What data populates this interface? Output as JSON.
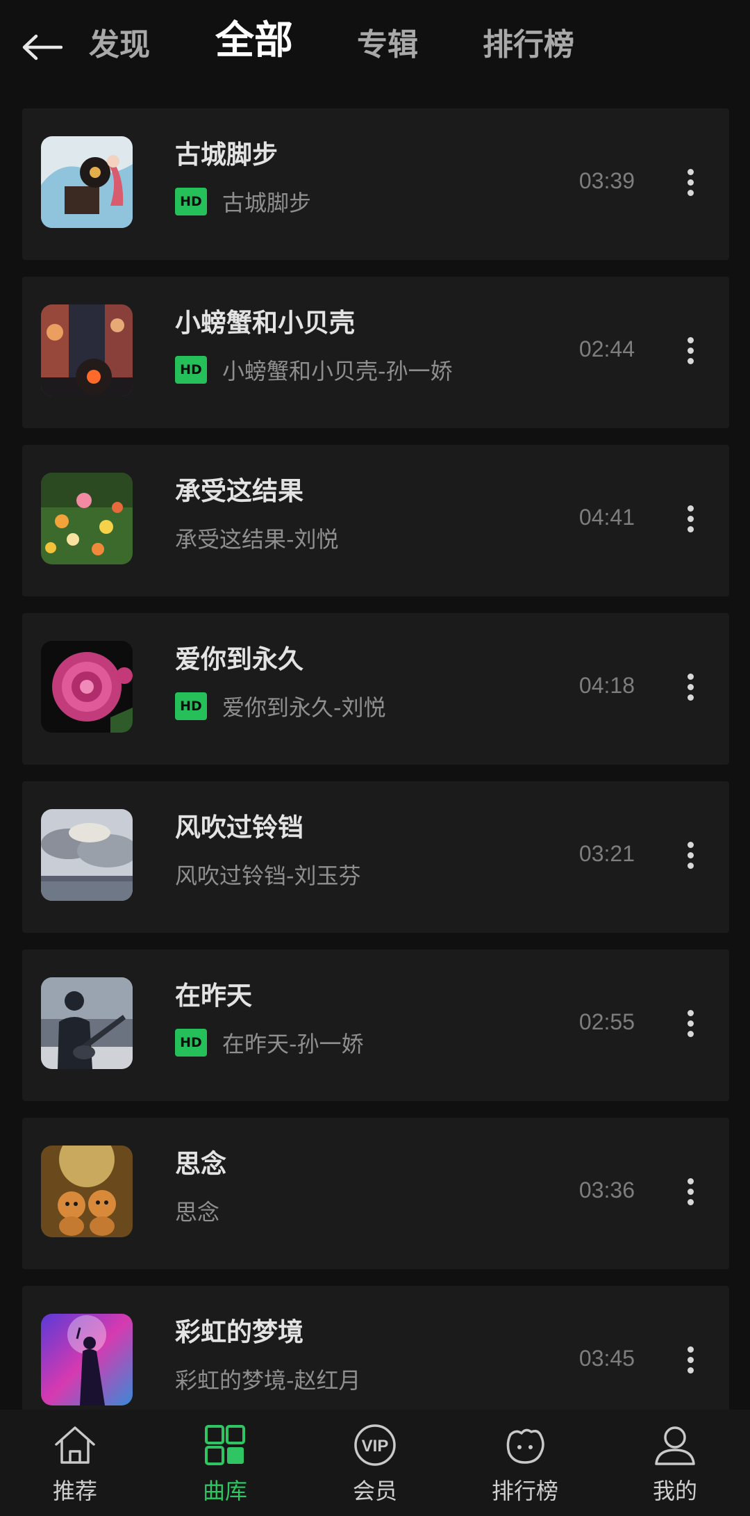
{
  "nav": {
    "tabs": [
      {
        "label": "发现"
      },
      {
        "label": "全部"
      },
      {
        "label": "专辑"
      },
      {
        "label": "排行榜"
      }
    ],
    "active_tab": "全部"
  },
  "badge_text": "HD",
  "songs": [
    {
      "title": "古城脚步",
      "subtitle": "古城脚步",
      "hd": true,
      "duration": "03:39"
    },
    {
      "title": "小螃蟹和小贝壳",
      "subtitle": "小螃蟹和小贝壳-孙一娇",
      "hd": true,
      "duration": "02:44"
    },
    {
      "title": "承受这结果",
      "subtitle": "承受这结果-刘悦",
      "hd": false,
      "duration": "04:41"
    },
    {
      "title": "爱你到永久",
      "subtitle": "爱你到永久-刘悦",
      "hd": true,
      "duration": "04:18"
    },
    {
      "title": "风吹过铃铛",
      "subtitle": "风吹过铃铛-刘玉芬",
      "hd": false,
      "duration": "03:21"
    },
    {
      "title": "在昨天",
      "subtitle": "在昨天-孙一娇",
      "hd": true,
      "duration": "02:55"
    },
    {
      "title": "思念",
      "subtitle": "思念",
      "hd": false,
      "duration": "03:36"
    },
    {
      "title": "彩虹的梦境",
      "subtitle": "彩虹的梦境-赵红月",
      "hd": false,
      "duration": "03:45"
    }
  ],
  "bottom_nav": [
    {
      "label": "推荐",
      "icon": "home-icon"
    },
    {
      "label": "曲库",
      "icon": "library-grid-icon"
    },
    {
      "label": "会员",
      "icon": "vip-icon"
    },
    {
      "label": "排行榜",
      "icon": "ranking-icon"
    },
    {
      "label": "我的",
      "icon": "profile-icon"
    }
  ],
  "colors": {
    "accent": "#25c05a",
    "background": "#101010",
    "card": "#1b1b1b"
  }
}
